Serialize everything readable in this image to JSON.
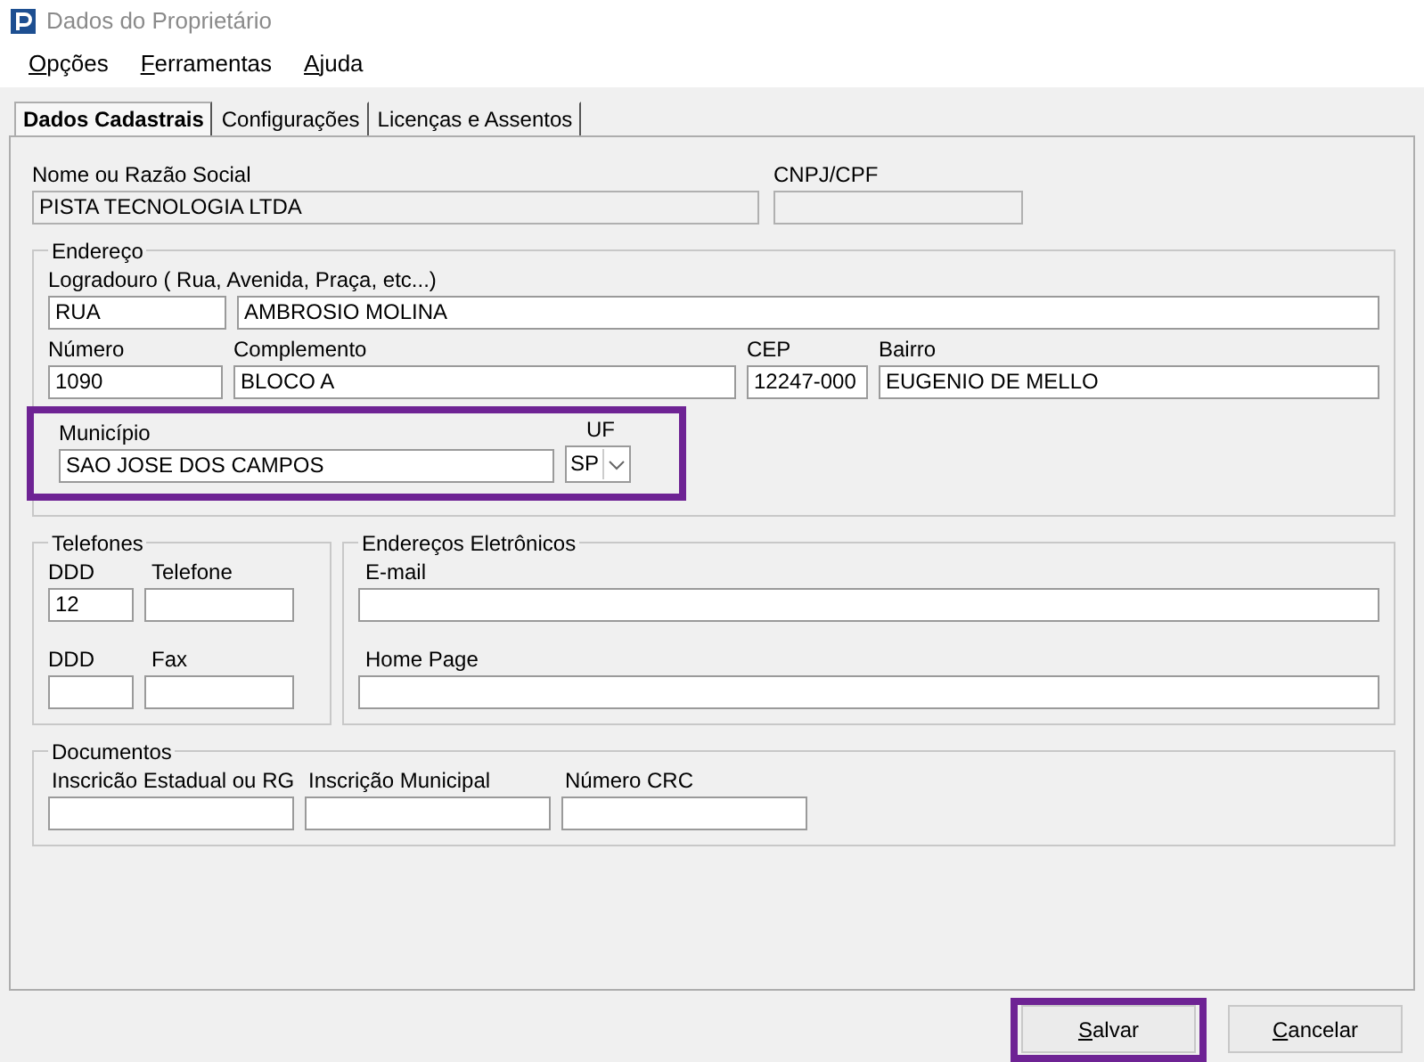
{
  "window": {
    "title": "Dados do Proprietário"
  },
  "menu": [
    {
      "label": "Opções",
      "underline_first": true
    },
    {
      "label": "Ferramentas",
      "underline_first": true
    },
    {
      "label": "Ajuda",
      "underline_first": true
    }
  ],
  "tabs": [
    {
      "label": "Dados Cadastrais",
      "selected": true
    },
    {
      "label": "Configurações",
      "selected": false
    },
    {
      "label": "Licenças e Assentos",
      "selected": false
    }
  ],
  "owner": {
    "name_label": "Nome ou Razão Social",
    "name_value": "PISTA TECNOLOGIA LTDA",
    "cnpj_label": "CNPJ/CPF"
  },
  "address": {
    "legend": "Endereço",
    "street_label": "Logradouro ( Rua, Avenida, Praça, etc...)",
    "street_type": "RUA",
    "street": "AMBROSIO MOLINA",
    "number_label": "Número",
    "number": "1090",
    "complement_label": "Complemento",
    "complement": "BLOCO A",
    "cep_label": "CEP",
    "cep": "12247-000",
    "district_label": "Bairro",
    "district": "EUGENIO DE MELLO",
    "city_label": "Município",
    "city": "SAO JOSE DOS CAMPOS",
    "uf_label": "UF",
    "uf": "SP",
    "city_highlighted": true
  },
  "phones": {
    "legend": "Telefones",
    "ddd_label": "DDD",
    "phone_label": "Telefone",
    "ddd": "12",
    "fax_ddd_label": "DDD",
    "fax_label": "Fax"
  },
  "electronic": {
    "legend": "Endereços Eletrônicos",
    "email_label": "E-mail",
    "homepage_label": "Home Page"
  },
  "documents": {
    "legend": "Documentos",
    "fields": [
      {
        "label": "Inscricão Estadual ou RG"
      },
      {
        "label": "Inscrição Municipal"
      },
      {
        "label": "Número CRC"
      }
    ]
  },
  "buttons": [
    {
      "label": "Salvar",
      "underline_first": true,
      "highlighted": true
    },
    {
      "label": "Cancelar",
      "underline_first": true,
      "highlighted": false
    }
  ]
}
